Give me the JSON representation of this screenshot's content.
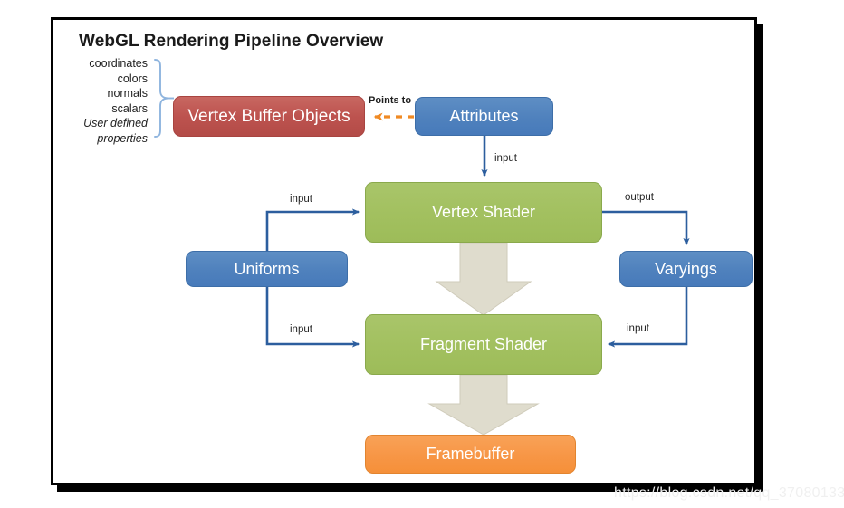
{
  "title": "WebGL Rendering Pipeline Overview",
  "source_list": {
    "items": [
      {
        "text": "coordinates",
        "italic": false
      },
      {
        "text": "colors",
        "italic": false
      },
      {
        "text": "normals",
        "italic": false
      },
      {
        "text": "scalars",
        "italic": false
      },
      {
        "text": "User defined",
        "italic": true
      },
      {
        "text": "properties",
        "italic": true
      }
    ]
  },
  "nodes": {
    "vertex_buffer_objects": {
      "label": "Vertex Buffer Objects",
      "color": "#bd534f"
    },
    "attributes": {
      "label": "Attributes",
      "color": "#4f81bd"
    },
    "vertex_shader": {
      "label": "Vertex Shader",
      "color": "#a2c05f"
    },
    "uniforms": {
      "label": "Uniforms",
      "color": "#4f81bd"
    },
    "varyings": {
      "label": "Varyings",
      "color": "#4f81bd"
    },
    "fragment_shader": {
      "label": "Fragment Shader",
      "color": "#a2c05f"
    },
    "framebuffer": {
      "label": "Framebuffer",
      "color": "#f79646"
    }
  },
  "edges": {
    "attributes_to_vbo": "Points to",
    "attributes_to_vertex": "input",
    "uniforms_to_vertex": "input",
    "uniforms_to_fragment": "input",
    "vertex_to_varyings": "output",
    "varyings_to_fragment": "input"
  },
  "colors": {
    "flow_arrow": "#dfdccd",
    "connector": "#2c5e9e",
    "dashed": "#f08a24",
    "bracket": "#8eb4de",
    "frame": "#000000"
  },
  "watermark": "https://blog.csdn.net/qq_37080133"
}
